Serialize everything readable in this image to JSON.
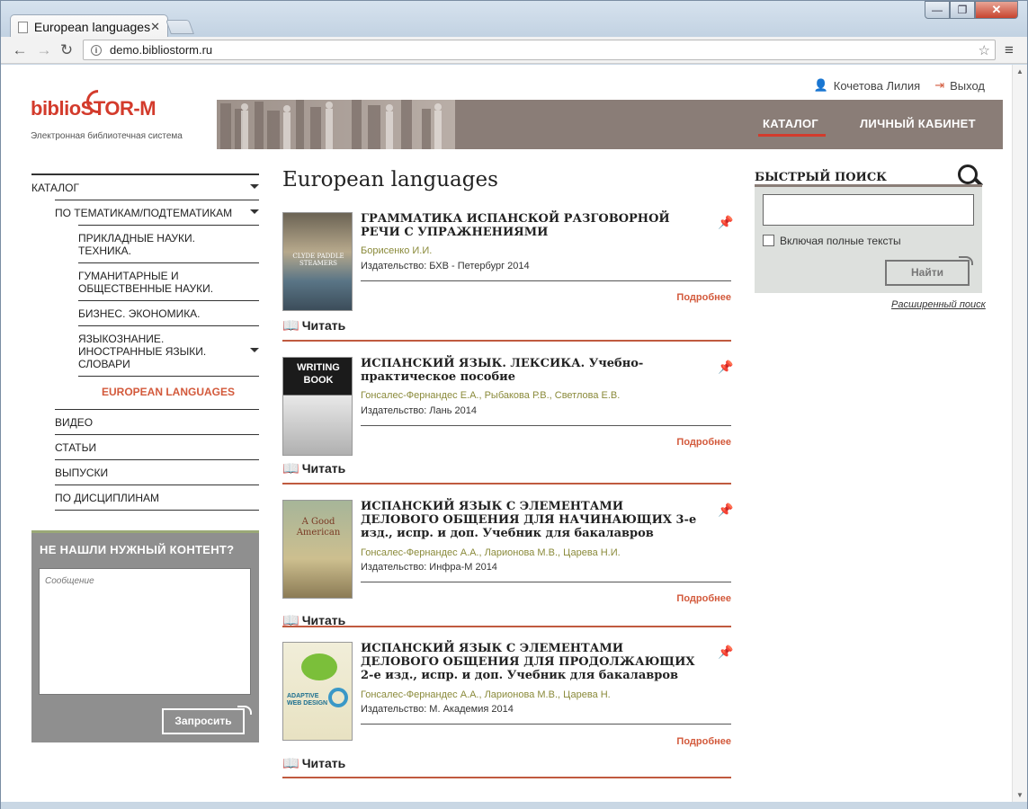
{
  "browser": {
    "tab_title": "European languages",
    "url": "demo.bibliostorm.ru",
    "close_symbol": "✕",
    "window_min": "—",
    "window_max": "❐",
    "window_close": "✕"
  },
  "header": {
    "user_name": "Кочетова Лилия",
    "logout_label": "Выход",
    "logo_text_1": "biblio",
    "logo_text_2": "STOR-M",
    "logo_subtitle": "Электронная библиотечная система",
    "nav": {
      "catalog": "КАТАЛОГ",
      "cabinet": "ЛИЧНЫЙ КАБИНЕТ"
    }
  },
  "sidebar": {
    "items": [
      {
        "label": "КАТАЛОГ"
      },
      {
        "label": "ПО ТЕМАТИКАМ/ПОДТЕМАТИКАМ"
      },
      {
        "label": "ПРИКЛАДНЫЕ НАУКИ. ТЕХНИКА."
      },
      {
        "label": "ГУМАНИТАРНЫЕ И ОБЩЕСТВЕННЫЕ НАУКИ."
      },
      {
        "label": "БИЗНЕС. ЭКОНОМИКА."
      },
      {
        "label": "ЯЗЫКОЗНАНИЕ. ИНОСТРАННЫЕ ЯЗЫКИ. СЛОВАРИ"
      },
      {
        "label": "EUROPEAN LANGUAGES"
      },
      {
        "label": "ВИДЕО"
      },
      {
        "label": "СТАТЬИ"
      },
      {
        "label": "ВЫПУСКИ"
      },
      {
        "label": "ПО ДИСЦИПЛИНАМ"
      }
    ],
    "request": {
      "title": "НЕ НАШЛИ НУЖНЫЙ КОНТЕНТ?",
      "placeholder": "Сообщение",
      "button": "Запросить"
    }
  },
  "main": {
    "title": "European languages",
    "more_label": "Подробнее",
    "read_label": "Читать",
    "books": [
      {
        "title": "ГРАММАТИКА ИСПАНСКОЙ РАЗГОВОРНОЙ РЕЧИ С УПРАЖНЕНИЯМИ",
        "authors": "Борисенко И.И.",
        "publisher": "Издательство: БХВ - Петербург 2014",
        "cover_text": "CLYDE PADDLE STEAMERS"
      },
      {
        "title": "ИСПАНСКИЙ ЯЗЫК. ЛЕКСИКА. Учебно-практическое пособие",
        "authors": "Гонсалес-Фернандес Е.А., Рыбакова Р.В., Светлова Е.В.",
        "publisher": "Издательство: Лань 2014",
        "cover_text": "WRITING BOOK"
      },
      {
        "title": "ИСПАНСКИЙ ЯЗЫК С ЭЛЕМЕНТАМИ ДЕЛОВОГО ОБЩЕНИЯ ДЛЯ НАЧИНАЮЩИХ 3-е изд., испр. и доп. Учебник для бакалавров",
        "authors": "Гонсалес-Фернандес А.А., Ларионова М.В., Царева Н.И.",
        "publisher": "Издательство: Инфра-М 2014",
        "cover_text": "A Good American"
      },
      {
        "title": "ИСПАНСКИЙ ЯЗЫК С ЭЛЕМЕНТАМИ ДЕЛОВОГО ОБЩЕНИЯ ДЛЯ ПРОДОЛЖАЮЩИХ 2-е изд., испр. и доп. Учебник для бакалавров",
        "authors": "Гонсалес-Фернандес А.А., Ларионова М.В., Царева Н.",
        "publisher": "Издательство: М. Академия 2014",
        "cover_text": "ADAPTIVE WEB DESIGN"
      }
    ]
  },
  "quick_search": {
    "title": "БЫСТРЫЙ ПОИСК",
    "checkbox_label": "Включая полные тексты",
    "button": "Найти",
    "advanced": "Расширенный поиск"
  },
  "colors": {
    "accent": "#d33b2c",
    "banner": "#8a7d77",
    "author": "#8a8a3a"
  }
}
